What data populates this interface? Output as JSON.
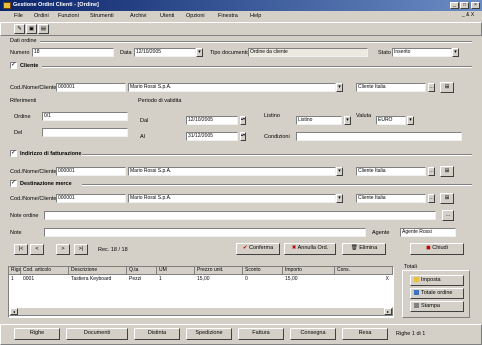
{
  "window": {
    "title": "Gestione Ordini Clienti - [Ordine]"
  },
  "menu": [
    "File",
    "Ordini",
    "Funzioni",
    "Strumenti",
    "Archivi",
    "Utenti",
    "Opzioni",
    "Finestra",
    "Help"
  ],
  "mdi": "_ & X",
  "head": {
    "section": "Dati ordine",
    "numero_label": "Numero",
    "numero_value": "18",
    "data_label": "Data",
    "data_value": "12/10/2005",
    "tipo_doc_label": "Tipo documento",
    "tipo_doc_value": "Ordine da cliente",
    "stato_label": "Stato",
    "stato_value": "Inserito"
  },
  "cliente": {
    "title": "Cliente",
    "cod_label": "Cod./Nome/Cliente",
    "cod_value": "000001",
    "name_value": "Mario Rossi S.p.A.",
    "extra_value": "Cliente Italia",
    "riferimenti": "Riferimenti",
    "ordine_label": "Ordine",
    "ordine_value": "0/1",
    "data_rif_label": "Del",
    "data_rif_value": "",
    "periodo_title": "Periodo di validita",
    "dal_label": "Dal",
    "dal_value": "12/10/2005",
    "al_label": "Al",
    "al_value": "31/12/2005",
    "listino_label": "Listino",
    "listino_value": "Listino",
    "valuta_label": "Valuta",
    "valuta_value": "EURO",
    "condizioni_label": "Condizioni",
    "condizioni_value": ""
  },
  "fatturare": {
    "title": "Indirizzo di fatturazione",
    "cod_label": "Cod./Nome/Cliente",
    "cod_value": "000001",
    "name_value": "Mario Rossi S.p.A.",
    "extra_value": "Cliente Italia"
  },
  "destinazione": {
    "title": "Destinazione merce",
    "cod_label": "Cod./Nome/Cliente",
    "cod_value": "000001",
    "name_value": "Mario Rossi S.p.A.",
    "extra_value": "Cliente Italia"
  },
  "notes": {
    "note_label": "Note ordine",
    "note_value": "",
    "note2_label": "Note",
    "note2_value": "",
    "agent_label": "Agente",
    "agent_value": "Agente Rossi"
  },
  "nav": {
    "first": "|<",
    "prev": "<",
    "next": ">",
    "last": ">|",
    "record_label": "Rec. 18 / 18",
    "confirm": "Conferma",
    "cancel": "Annulla Ord.",
    "delete": "Elimina",
    "close": "Chiudi"
  },
  "grid": {
    "headers": [
      "Riga",
      "Cod. articolo",
      "Descrizione",
      "Q.ta",
      "UM",
      "Prezzo unit.",
      "Sconto",
      "Importo",
      "Cons."
    ],
    "rows": [
      [
        "1",
        "0001",
        "Tastiera Keyboard",
        "Pezzi",
        "1",
        "15,00",
        "0",
        "15,00",
        "X"
      ]
    ]
  },
  "side": {
    "title": "Totali",
    "b1": "Imposta",
    "b2": "Totale ordine",
    "b3": "Stampa"
  },
  "status": {
    "tabs": [
      "Righe",
      "Documenti",
      "Distinta",
      "Spedizione",
      "Fattura",
      "Consegna",
      "Resa"
    ],
    "right": "Righe 1 di 1"
  },
  "colors": {
    "title_start": "#0a246a",
    "title_end": "#6a8cc4",
    "face": "#d4d0c8",
    "red": "#c00000"
  }
}
